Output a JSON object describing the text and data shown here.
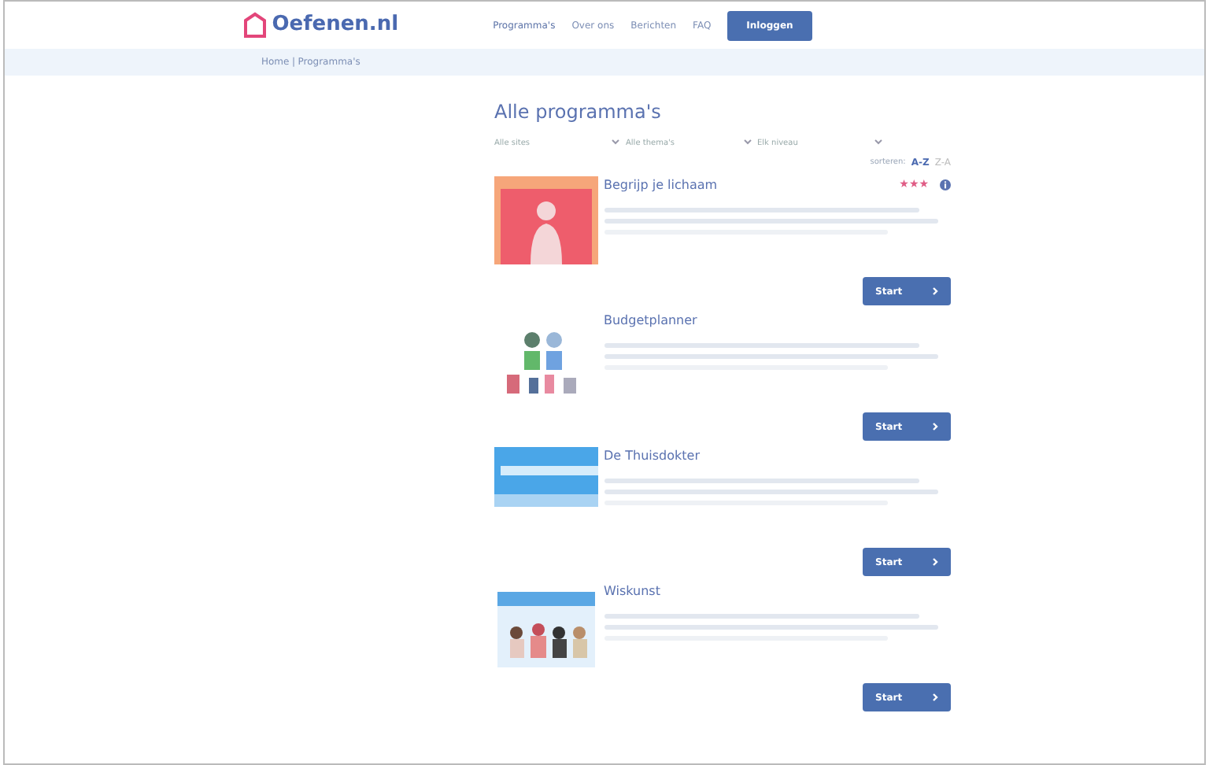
{
  "logo": {
    "text": "Oefenen.nl"
  },
  "nav": [
    {
      "label": "Programma's",
      "selected": true
    },
    {
      "label": "Over ons",
      "selected": false
    },
    {
      "label": "Berichten",
      "selected": false
    },
    {
      "label": "FAQ",
      "selected": false
    }
  ],
  "login_button": "Inloggen",
  "breadcrumb": [
    "Home",
    "|",
    "Programma's"
  ],
  "heading": "Alle programma's",
  "filters": [
    {
      "label": "Alle sites"
    },
    {
      "label": "Alle thema's"
    },
    {
      "label": "Elk niveau"
    }
  ],
  "sort": {
    "label": "sorteren:",
    "options": [
      {
        "label": "A-Z",
        "selected": true
      },
      {
        "label": "Z-A",
        "selected": false
      }
    ]
  },
  "programs": [
    {
      "title": "Begrijp je lichaam",
      "stars": 3,
      "info": true,
      "button": "Start"
    },
    {
      "title": "Budgetplanner",
      "button": "Start"
    },
    {
      "title": "De Thuisdokter",
      "button": "Start"
    },
    {
      "title": "Wiskunst",
      "button": "Start"
    }
  ]
}
